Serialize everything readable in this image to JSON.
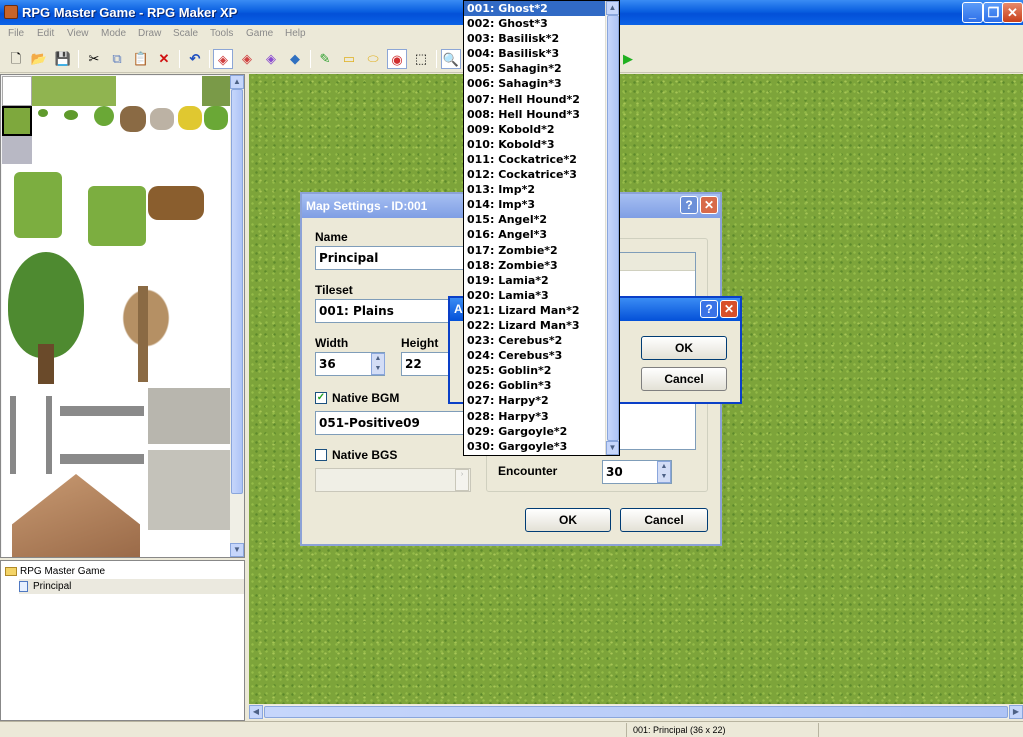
{
  "window": {
    "title": "RPG Master Game - RPG Maker XP"
  },
  "menu": [
    "File",
    "Edit",
    "View",
    "Mode",
    "Draw",
    "Scale",
    "Tools",
    "Game",
    "Help"
  ],
  "toolbar_icons": [
    "new-icon",
    "open-icon",
    "save-icon",
    "cut-icon",
    "copy-icon",
    "paste-icon",
    "delete-icon",
    "undo-icon",
    "layer1-icon",
    "layer2-icon",
    "layer3-icon",
    "events-icon",
    "pencil-icon",
    "rectangle-icon",
    "ellipse-icon",
    "fill-icon",
    "select-icon",
    "zoom-icon",
    "play-icon"
  ],
  "tree": {
    "root": "RPG Master Game",
    "child": "Principal"
  },
  "status": {
    "map_info": "001: Principal (36 x 22)"
  },
  "map_settings": {
    "title": "Map Settings - ID:001",
    "name_label": "Name",
    "name_value": "Principal",
    "tileset_label": "Tileset",
    "tileset_value": "001: Plains",
    "width_label": "Width",
    "width_value": "36",
    "height_label": "Height",
    "height_value": "22",
    "native_bgm_label": "Native BGM",
    "native_bgm_checked": true,
    "bgm_value": "051-Positive09",
    "native_bgs_label": "Native BGS",
    "native_bgs_checked": false,
    "encounter_label": "Encounter",
    "encounter_value": "30",
    "ok_label": "OK",
    "cancel_label": "Cancel"
  },
  "sub_dialog": {
    "title_initial": "A",
    "ok_label": "OK",
    "cancel_label": "Cancel"
  },
  "troop_dropdown": {
    "selected_index": 0,
    "items": [
      "001: Ghost*2",
      "002: Ghost*3",
      "003: Basilisk*2",
      "004: Basilisk*3",
      "005: Sahagin*2",
      "006: Sahagin*3",
      "007: Hell Hound*2",
      "008: Hell Hound*3",
      "009: Kobold*2",
      "010: Kobold*3",
      "011: Cockatrice*2",
      "012: Cockatrice*3",
      "013: Imp*2",
      "014: Imp*3",
      "015: Angel*2",
      "016: Angel*3",
      "017: Zombie*2",
      "018: Zombie*3",
      "019: Lamia*2",
      "020: Lamia*3",
      "021: Lizard Man*2",
      "022: Lizard Man*3",
      "023: Cerebus*2",
      "024: Cerebus*3",
      "025: Goblin*2",
      "026: Goblin*3",
      "027: Harpy*2",
      "028: Harpy*3",
      "029: Gargoyle*2",
      "030: Gargoyle*3"
    ]
  },
  "colors": {
    "title_blue": "#0350d8",
    "selection": "#316ac5",
    "grass": "#7da43a"
  }
}
